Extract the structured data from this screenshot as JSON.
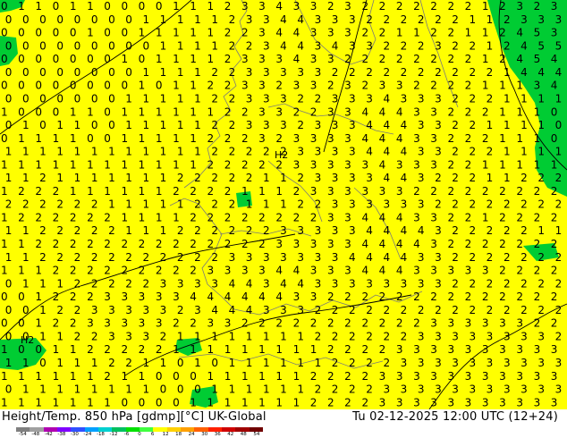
{
  "footer": {
    "title": "Height/Temp. 850 hPa [gdmp][°C] UK-Global",
    "valid_time": "Tu 02-12-2025 12:00 UTC (12+24)"
  },
  "map": {
    "field_values": [
      "0 1 1 0 1 1 0 0 0 0 1 1 1 2 3 3 4 3 3 2 3 2 2 2 2 2 2 2 1 2 3 2 3",
      "0 0 0 0 0 0 0 0 1 1 1 1 1 2 3 3 4 4 3 3 3 2 2 2 2 2 2 1 1 2 3 3 3",
      "0 0 0 0 0 1 0 0 1 1 1 1 1 2 2 3 4 4 3 3 3 2 2 1 1 2 2 1 1 2 4 5 3",
      "0 0 0 0 0 0 0 0 0 1 1 1 1 2 2 3 4 4 3 4 3 3 2 2 2 3 2 2 1 2 4 5 5",
      "0 0 0 0 0 0 0 1 0 1 1 1 1 2 3 3 3 4 3 3 2 2 2 2 2 2 2 2 1 2 4 5 4",
      "0 0 0 0 0 0 0 0 1 1 1 1 2 2 3 3 3 3 3 2 2 2 2 2 2 2 2 2 2 1 4 4 4",
      "0 0 0 0 0 0 0 0 1 0 1 1 2 2 3 3 2 3 3 2 3 2 3 3 2 2 2 2 1 1 1 3 4",
      "0 0 0 0 0 0 0 1 1 1 1 1 2 2 3 3 3 2 2 3 3 3 4 3 3 3 2 2 2 1 1 1 1",
      "1 0 0 0 1 1 0 1 1 1 1 1 1 2 2 3 3 2 2 3 3 4 4 4 3 3 2 2 2 1 1 1 0",
      "0 1 0 1 1 0 0 1 1 1 1 1 2 2 3 3 3 2 3 3 3 4 4 4 3 3 2 2 1 1 1 1 0",
      "0 1 1 1 1 0 0 1 1 1 1 1 2 2 2 3 2 3 3 3 3 4 4 4 3 3 2 2 2 1 1 1 0",
      "1 1 1 1 1 1 1 1 1 1 1 1 2 2 2 2 2 3 3 3 3 4 4 4 3 3 2 2 2 1 1 1 1",
      "1 1 1 1 1 1 1 1 1 1 1 1 2 2 2 2 2 3 3 3 3 3 4 3 3 3 2 2 1 1 1 1 1",
      "1 1 2 1 1 1 1 1 1 1 2 2 2 2 2 1 1 2 3 3 3 3 4 4 3 2 2 2 1 1 2 2 2",
      "1 2 2 2 1 1 1 1 1 1 2 2 2 2 1 1 1 2 3 3 3 3 3 3 2 2 2 2 2 2 2 2 2",
      "2 2 2 2 2 2 1 1 1 1 1 2 2 2 1 1 1 2 2 3 3 3 3 3 3 2 2 2 2 2 2 2 2",
      "1 2 2 2 2 2 2 1 1 1 1 2 2 2 2 2 2 2 2 3 3 4 4 4 3 3 2 2 1 2 2 2 2",
      "1 1 2 2 2 2 2 1 1 1 2 2 2 2 2 2 3 3 3 3 3 4 4 4 4 3 2 2 2 2 2 1 1",
      "1 1 2 2 2 2 2 2 2 2 2 2 2 2 2 2 3 3 3 3 3 4 4 4 4 3 2 2 2 2 2 2 2",
      "1 1 2 2 2 2 2 2 2 2 2 2 2 3 3 3 3 3 3 3 4 4 4 4 3 3 2 2 2 2 2 2 2",
      "1 1 1 2 2 2 2 2 2 2 2 2 3 3 3 3 4 4 3 3 3 4 4 4 3 3 3 3 3 2 2 2 2",
      "0 1 1 1 2 2 2 2 2 3 3 3 3 4 4 3 4 4 3 3 3 3 3 3 3 3 2 2 2 2 2 2 2",
      "0 0 1 2 2 2 3 3 3 3 3 4 4 4 4 4 4 3 3 2 2 2 2 2 2 2 2 2 2 2 2 2 2",
      "0 0 1 2 2 3 3 3 3 3 2 3 4 4 4 3 3 3 2 2 2 2 2 2 2 2 2 2 2 2 2 2 2",
      "0 0 1 2 2 3 3 3 3 3 2 2 3 3 2 2 2 2 2 2 2 2 2 2 2 3 3 3 3 3 3 2 2",
      "0 0 1 1 2 2 3 3 3 2 1 1 1 1 1 1 1 1 2 2 2 2 2 2 3 3 3 3 3 3 3 3 2",
      "1 0 0 1 1 2 2 2 2 2 1 1 1 1 1 1 1 1 1 2 2 2 2 3 3 3 3 3 3 3 3 3 3",
      "1 1 0 1 1 1 2 2 1 1 0 1 0 1 1 1 1 1 1 2 2 2 2 3 3 3 3 3 3 3 3 3 3",
      "1 1 1 1 1 1 2 1 1 0 0 0 1 1 1 1 1 1 2 2 2 2 3 3 3 3 3 3 3 3 3 3 3",
      "0 1 1 1 1 1 1 1 1 0 0 0 1 1 1 1 1 1 2 2 2 2 3 3 3 3 3 3 3 3 3 3 3",
      "1 1 1 1 1 1 1 0 0 0 0 1 1 1 1 1 1 1 2 2 2 2 3 3 3 3 3 3 3 3 3 3 3"
    ],
    "pressure_labels": [
      "H2",
      "H2"
    ],
    "land_color": "#ffff00",
    "zero_region_color": "#00cc33",
    "coast_color": "#7a7a7a"
  },
  "color_scale": {
    "labels": [
      "-54",
      "-48",
      "-42",
      "-38",
      "-30",
      "-24",
      "-18",
      "-12",
      "-6",
      "0",
      "6",
      "12",
      "18",
      "24",
      "30",
      "36",
      "42",
      "48",
      "54"
    ],
    "colors": [
      "#808080",
      "#a0a0a0",
      "#b000b0",
      "#8000ff",
      "#3050ff",
      "#00a0ff",
      "#00d0d0",
      "#00c060",
      "#00e000",
      "#40ff40",
      "#ffff00",
      "#ffd000",
      "#ffa000",
      "#ff6000",
      "#ff2000",
      "#d00000",
      "#a00000",
      "#700000"
    ]
  }
}
